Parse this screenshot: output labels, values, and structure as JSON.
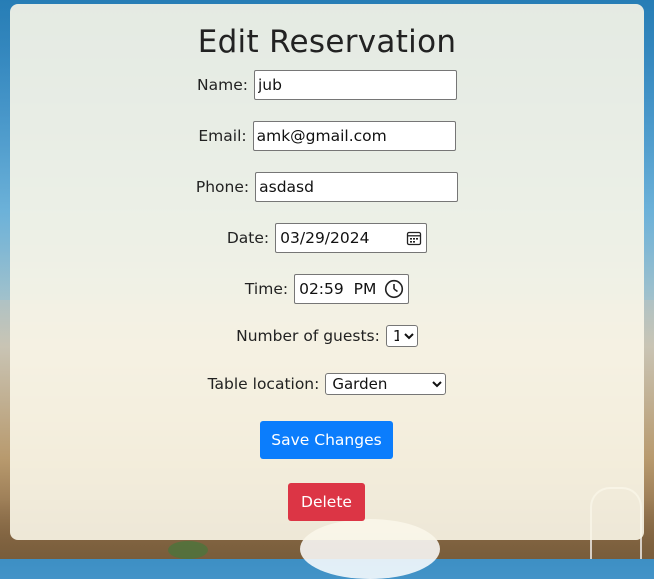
{
  "page": {
    "title": "Edit Reservation"
  },
  "form": {
    "name_label": "Name:",
    "name_value": "jub",
    "email_label": "Email:",
    "email_value": "amk@gmail.com",
    "phone_label": "Phone:",
    "phone_value": "asdasd",
    "date_label": "Date:",
    "date_value": "03/29/2024",
    "time_label": "Time:",
    "time_value": "02:59  PM",
    "guests_label": "Number of guests:",
    "guests_value": "1",
    "location_label": "Table location:",
    "location_value": "Garden"
  },
  "actions": {
    "save_label": "Save Changes",
    "delete_label": "Delete"
  },
  "colors": {
    "save": "#0b7dfc",
    "delete": "#dc3545",
    "card": "#faf6e8"
  },
  "icons": {
    "date": "calendar-icon",
    "time": "clock-icon"
  }
}
